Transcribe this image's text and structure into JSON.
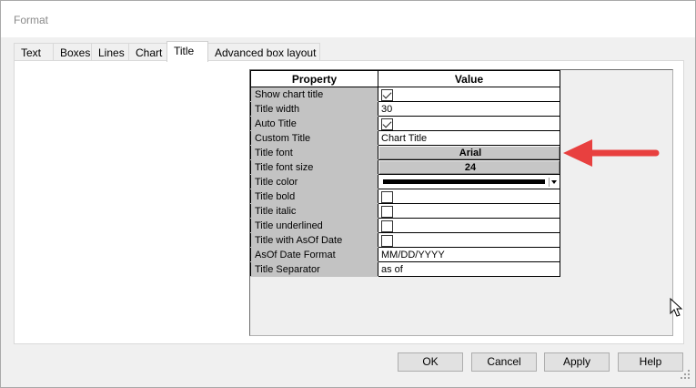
{
  "window": {
    "title": "Format"
  },
  "tabs": [
    {
      "label": "Text"
    },
    {
      "label": "Boxes"
    },
    {
      "label": "Lines"
    },
    {
      "label": "Chart"
    },
    {
      "label": "Title"
    },
    {
      "label": "Advanced box layout"
    }
  ],
  "active_tab": "Title",
  "grid": {
    "header_property": "Property",
    "header_value": "Value",
    "rows": [
      {
        "property": "Show chart title",
        "type": "checkbox",
        "checked": true
      },
      {
        "property": "Title width",
        "type": "text",
        "value": "30"
      },
      {
        "property": "Auto Title",
        "type": "checkbox",
        "checked": true
      },
      {
        "property": "Custom Title",
        "type": "text",
        "value": "Chart Title"
      },
      {
        "property": "Title font",
        "type": "button",
        "value": "Arial"
      },
      {
        "property": "Title font size",
        "type": "button",
        "value": "24"
      },
      {
        "property": "Title color",
        "type": "color",
        "color": "#000000"
      },
      {
        "property": "Title bold",
        "type": "checkbox",
        "checked": false
      },
      {
        "property": "Title italic",
        "type": "checkbox",
        "checked": false
      },
      {
        "property": "Title underlined",
        "type": "checkbox",
        "checked": false
      },
      {
        "property": "Title with AsOf Date",
        "type": "checkbox",
        "checked": false
      },
      {
        "property": "AsOf Date Format",
        "type": "text",
        "value": "MM/DD/YYYY"
      },
      {
        "property": "Title Separator",
        "type": "text",
        "value": "as of"
      }
    ]
  },
  "buttons": {
    "ok": "OK",
    "cancel": "Cancel",
    "apply": "Apply",
    "help": "Help"
  },
  "colors": {
    "annotation_arrow": "#e8403f",
    "dialog_bg": "#f0f0f0"
  }
}
